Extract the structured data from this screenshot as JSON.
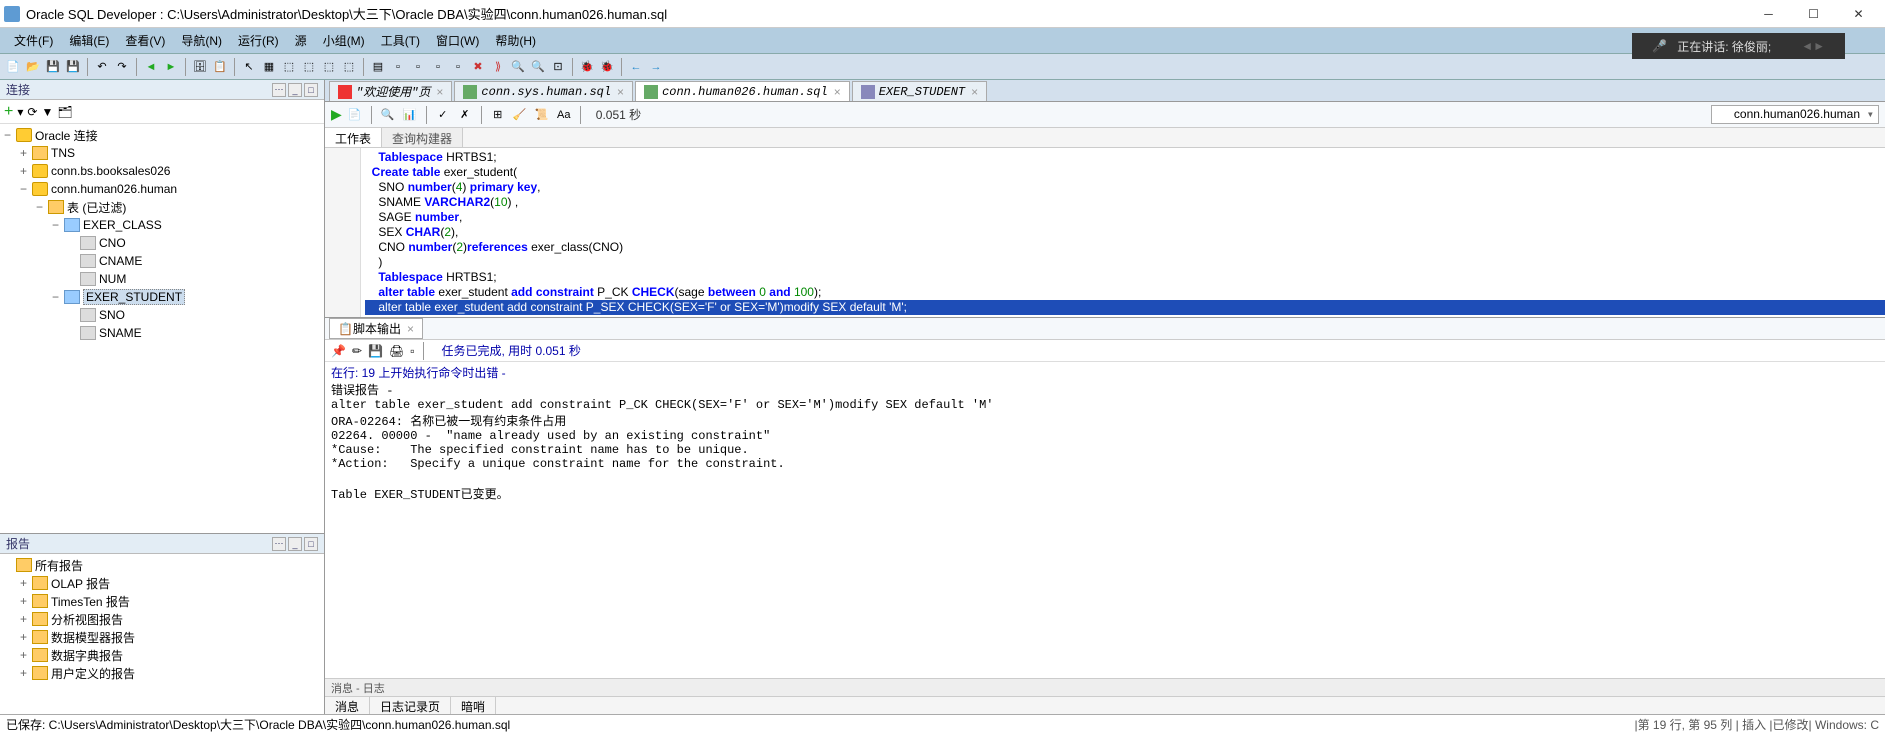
{
  "title": "Oracle SQL Developer : C:\\Users\\Administrator\\Desktop\\大三下\\Oracle DBA\\实验四\\conn.human026.human.sql",
  "speaking": {
    "label": "正在讲话: 徐俊丽;"
  },
  "menu": [
    "文件(F)",
    "编辑(E)",
    "查看(V)",
    "导航(N)",
    "运行(R)",
    "源",
    "小组(M)",
    "工具(T)",
    "窗口(W)",
    "帮助(H)"
  ],
  "panels": {
    "connections": "连接",
    "reports": "报告"
  },
  "connTree": {
    "root": "Oracle 连接",
    "nodes": [
      {
        "l": 1,
        "ico": "fold",
        "tgl": "+",
        "lbl": "TNS"
      },
      {
        "l": 1,
        "ico": "db",
        "tgl": "+",
        "lbl": "conn.bs.booksales026"
      },
      {
        "l": 1,
        "ico": "db",
        "tgl": "−",
        "lbl": "conn.human026.human"
      },
      {
        "l": 2,
        "ico": "fold",
        "tgl": "−",
        "lbl": "表 (已过滤)"
      },
      {
        "l": 3,
        "ico": "tbl",
        "tgl": "−",
        "lbl": "EXER_CLASS"
      },
      {
        "l": 4,
        "ico": "col",
        "lbl": "CNO"
      },
      {
        "l": 4,
        "ico": "col",
        "lbl": "CNAME"
      },
      {
        "l": 4,
        "ico": "col",
        "lbl": "NUM"
      },
      {
        "l": 3,
        "ico": "tbl",
        "tgl": "−",
        "lbl": "EXER_STUDENT",
        "sel": true
      },
      {
        "l": 4,
        "ico": "col",
        "lbl": "SNO"
      },
      {
        "l": 4,
        "ico": "col",
        "lbl": "SNAME"
      }
    ]
  },
  "reports": [
    "所有报告",
    "OLAP 报告",
    "TimesTen 报告",
    "分析视图报告",
    "数据模型器报告",
    "数据字典报告",
    "用户定义的报告"
  ],
  "editorTabs": [
    {
      "ico": "welcome",
      "lbl": "\"欢迎使用\"页"
    },
    {
      "ico": "sql",
      "lbl": "conn.sys.human.sql"
    },
    {
      "ico": "sql",
      "lbl": "conn.human026.human.sql",
      "active": true
    },
    {
      "ico": "grid",
      "lbl": "EXER_STUDENT"
    }
  ],
  "sqlToolbar": {
    "timing": "0.051 秒",
    "connection": "conn.human026.human"
  },
  "wsTabs": {
    "ws": "工作表",
    "qb": "查询构建器"
  },
  "code": [
    {
      "t": "Tablespace HRTBS1;",
      "indent": 2
    },
    {
      "t": "Create table exer_student(",
      "indent": 1,
      "fold": "⊟"
    },
    {
      "t": "SNO number(4) primary key,",
      "indent": 2
    },
    {
      "t": "SNAME VARCHAR2(10) ,",
      "indent": 2
    },
    {
      "t": "SAGE number,",
      "indent": 2
    },
    {
      "t": "SEX CHAR(2),",
      "indent": 2
    },
    {
      "t": "CNO number(2)references exer_class(CNO)",
      "indent": 2
    },
    {
      "t": ")",
      "indent": 2
    },
    {
      "t": "Tablespace HRTBS1;",
      "indent": 2
    },
    {
      "t": "alter table exer_student add constraint P_CK CHECK(sage between 0 and 100);",
      "indent": 2
    },
    {
      "t": "alter table exer_student add constraint P_SEX CHECK(SEX='F' or SEX='M')modify SEX default 'M';",
      "indent": 2,
      "hl": true
    }
  ],
  "output": {
    "tab": "脚本输出",
    "status": "任务已完成, 用时 0.051 秒",
    "lines": [
      "错误报告 -",
      "alter table exer_student add constraint P_CK CHECK(SEX='F' or SEX='M')modify SEX default 'M'",
      "ORA-02264: 名称已被一现有约束条件占用",
      "02264. 00000 -  \"name already used by an existing constraint\"",
      "*Cause:    The specified constraint name has to be unique.",
      "*Action:   Specify a unique constraint name for the constraint.",
      "",
      "Table EXER_STUDENT已变更。"
    ]
  },
  "msgBar": "消息 - 日志",
  "msgTabs": [
    "消息",
    "日志记录页",
    "暗哨"
  ],
  "statusbar": {
    "left": "已保存: C:\\Users\\Administrator\\Desktop\\大三下\\Oracle DBA\\实验四\\conn.human026.human.sql",
    "right": "|第 19 行, 第 95 列   |   插入  |已修改| Windows: C"
  }
}
